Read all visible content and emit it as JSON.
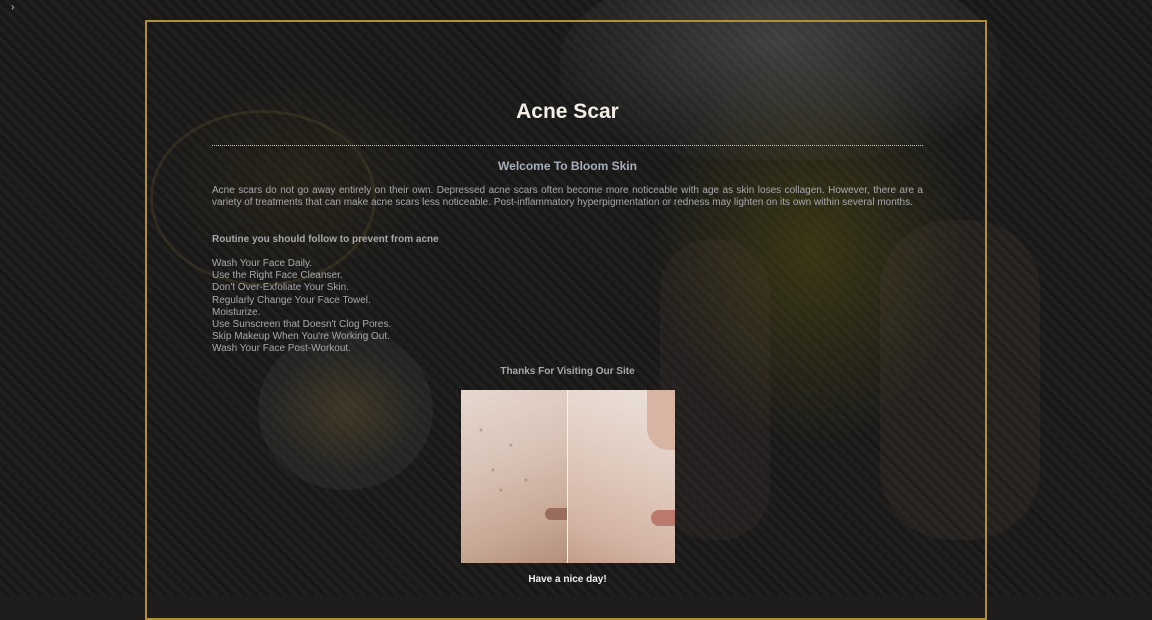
{
  "page": {
    "title": "Acne Scar",
    "welcome_heading": "Welcome To Bloom Skin",
    "intro_paragraph": "Acne scars do not go away entirely on their own. Depressed acne scars often become more noticeable with age as skin loses collagen. However, there are a variety of treatments that can make acne scars less noticeable. Post-inflammatory hyperpigmentation or redness may lighten on its own within several months.",
    "routine_heading": "Routine you should follow to prevent from acne",
    "tips": [
      "Wash Your Face Daily.",
      "Use the Right Face Cleanser.",
      "Don't Over-Exfoliate Your Skin.",
      "Regularly Change Your Face Towel.",
      "Moisturize.",
      "Use Sunscreen that Doesn't Clog Pores.",
      "Skip Makeup When You're Working Out.",
      "Wash Your Face Post-Workout."
    ],
    "thanks_text": "Thanks For Visiting Our Site",
    "closing_text": "Have a nice day!"
  },
  "icons": {
    "corner": "chevron-right-icon"
  },
  "colors": {
    "frame_border": "#b08f3c",
    "title": "#f3efe6",
    "body_text": "#a9a9ad",
    "welcome": "#a8b0bc"
  }
}
